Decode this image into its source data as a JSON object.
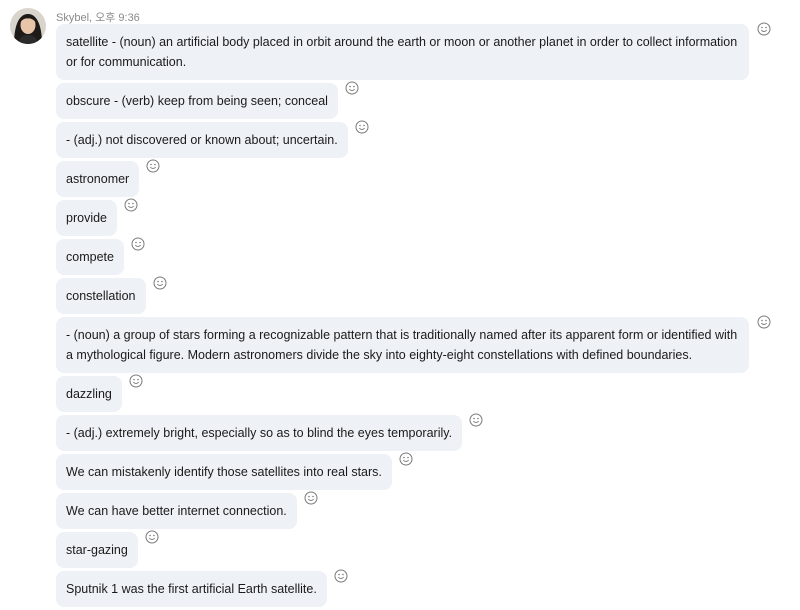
{
  "sender": {
    "name": "Skybel",
    "time": "오후 9:36"
  },
  "messages": [
    {
      "text": "satellite - (noun) an artificial body placed in orbit around the earth or moon or another planet in order to collect information or for communication."
    },
    {
      "text": "obscure - (verb) keep from being seen; conceal"
    },
    {
      "text": "- (adj.) not discovered or known about; uncertain."
    },
    {
      "text": "astronomer"
    },
    {
      "text": "provide"
    },
    {
      "text": "compete"
    },
    {
      "text": "constellation"
    },
    {
      "text": "- (noun) a group of stars forming a recognizable pattern that is traditionally named after its apparent form or identified with a mythological figure. Modern astronomers divide the sky into eighty-eight constellations with defined boundaries."
    },
    {
      "text": "dazzling"
    },
    {
      "text": "- (adj.) extremely bright, especially so as to blind the eyes temporarily."
    },
    {
      "text": "We can mistakenly identify those satellites into real stars."
    },
    {
      "text": "We can have better internet connection."
    },
    {
      "text": "star-gazing"
    },
    {
      "text": "Sputnik 1 was the first artificial Earth satellite."
    }
  ],
  "icons": {
    "reaction": "smiley-icon",
    "avatar": "avatar"
  },
  "colors": {
    "bubble": "#eef2f6",
    "meta": "#8a8a8a"
  }
}
